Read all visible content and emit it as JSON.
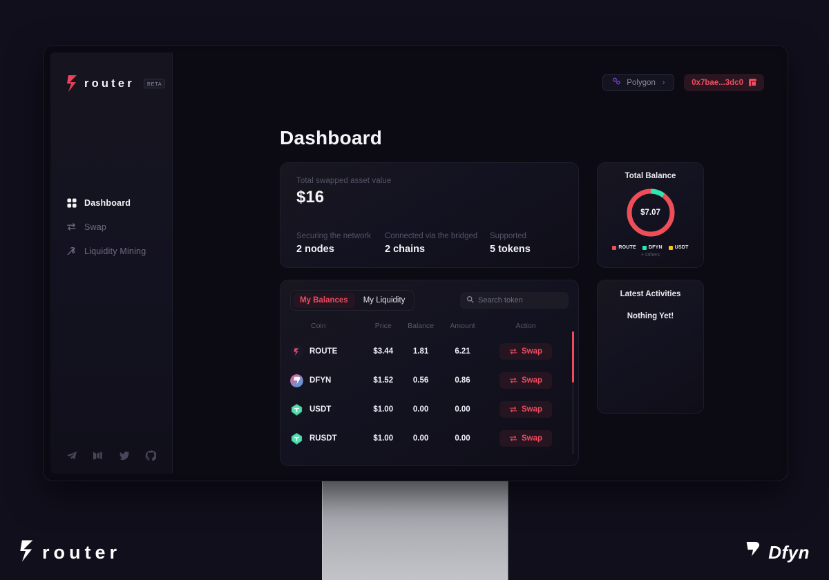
{
  "brand": {
    "name": "router",
    "badge": "BETA",
    "mark_icon": "router-logo-icon"
  },
  "sidebar": {
    "items": [
      {
        "label": "Dashboard",
        "icon": "grid-icon",
        "active": true
      },
      {
        "label": "Swap",
        "icon": "swap-arrows-icon",
        "active": false
      },
      {
        "label": "Liquidity Mining",
        "icon": "mining-pickaxe-icon",
        "active": false
      }
    ],
    "socials": [
      {
        "name": "telegram-icon"
      },
      {
        "name": "medium-icon"
      },
      {
        "name": "twitter-icon"
      },
      {
        "name": "github-icon"
      }
    ]
  },
  "topbar": {
    "chain": {
      "label": "Polygon",
      "chevron": "›",
      "icon": "polygon-icon"
    },
    "wallet": {
      "address": "0x7bae...3dc0",
      "copy_icon": "copy-icon"
    }
  },
  "page": {
    "title": "Dashboard"
  },
  "stats": {
    "total_label": "Total swapped asset value",
    "total_value": "$16",
    "items": [
      {
        "label": "Securing the network",
        "value": "2 nodes"
      },
      {
        "label": "Connected via the bridged",
        "value": "2 chains"
      },
      {
        "label": "Supported",
        "value": "5 tokens"
      }
    ]
  },
  "balance": {
    "title": "Total Balance",
    "center_value": "$7.07",
    "others_label": "+ Others"
  },
  "chart_data": {
    "type": "pie",
    "title": "Total Balance",
    "center_label": "$7.07",
    "categories": [
      "ROUTE",
      "DFYN",
      "USDT"
    ],
    "values": [
      84,
      16,
      0
    ],
    "colors": [
      "#ee4e58",
      "#2ce8b0",
      "#f5c518"
    ],
    "legend": "bottom",
    "donut": true,
    "note": "+ Others"
  },
  "tokens_panel": {
    "tabs": [
      {
        "label": "My Balances",
        "active": true
      },
      {
        "label": "My Liquidity",
        "active": false
      }
    ],
    "search": {
      "placeholder": "Search token",
      "value": "",
      "icon": "search-icon"
    },
    "columns": [
      "Coin",
      "Price",
      "Balance",
      "Amount",
      "Action"
    ],
    "rows": [
      {
        "coin": "ROUTE",
        "price": "$3.44",
        "balance": "1.81",
        "amount": "6.21",
        "action": "Swap",
        "icon": "route-token-icon"
      },
      {
        "coin": "DFYN",
        "price": "$1.52",
        "balance": "0.56",
        "amount": "0.86",
        "action": "Swap",
        "icon": "dfyn-token-icon"
      },
      {
        "coin": "USDT",
        "price": "$1.00",
        "balance": "0.00",
        "amount": "0.00",
        "action": "Swap",
        "icon": "usdt-token-icon"
      },
      {
        "coin": "RUSDT",
        "price": "$1.00",
        "balance": "0.00",
        "amount": "0.00",
        "action": "Swap",
        "icon": "rusdt-token-icon"
      }
    ]
  },
  "activities": {
    "title": "Latest Activities",
    "empty": "Nothing Yet!"
  },
  "footer": {
    "router_word": "router",
    "dfyn_word": "Dfyn"
  },
  "colors": {
    "accent": "#ef4b60",
    "green": "#2ce8b0",
    "yellow": "#f5c518",
    "page_bg": "#110f1c"
  }
}
